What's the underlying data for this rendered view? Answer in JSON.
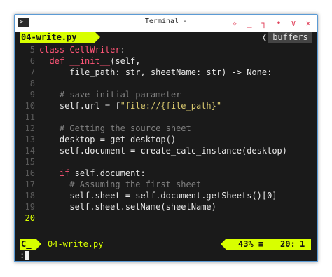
{
  "window": {
    "title": "Terminal -",
    "icon": "terminal-icon",
    "controls": [
      "pin-icon",
      "minimize-icon",
      "maximize-icon",
      "menu-icon",
      "chevron-down-icon",
      "close-icon"
    ]
  },
  "tabline": {
    "file": "04-write.py",
    "buffers_label": "buffers"
  },
  "code": [
    {
      "n": "5",
      "tokens": [
        [
          "kw",
          "class "
        ],
        [
          "fn",
          "CellWriter"
        ],
        [
          "src",
          ":"
        ]
      ]
    },
    {
      "n": "6",
      "tokens": [
        [
          "src",
          "  "
        ],
        [
          "kw",
          "def "
        ],
        [
          "fn",
          "__init__"
        ],
        [
          "src",
          "(self,"
        ]
      ]
    },
    {
      "n": "7",
      "tokens": [
        [
          "src",
          "      file_path: str, sheetName: str) -> None:"
        ]
      ]
    },
    {
      "n": "8",
      "tokens": []
    },
    {
      "n": "9",
      "tokens": [
        [
          "src",
          "    "
        ],
        [
          "cm",
          "# save initial parameter"
        ]
      ]
    },
    {
      "n": "10",
      "tokens": [
        [
          "src",
          "    self.url = f"
        ],
        [
          "st",
          "\"file://{file_path}\""
        ]
      ]
    },
    {
      "n": "11",
      "tokens": []
    },
    {
      "n": "12",
      "tokens": [
        [
          "src",
          "    "
        ],
        [
          "cm",
          "# Getting the source sheet"
        ]
      ]
    },
    {
      "n": "13",
      "tokens": [
        [
          "src",
          "    desktop = get_desktop()"
        ]
      ]
    },
    {
      "n": "14",
      "tokens": [
        [
          "src",
          "    self.document = create_calc_instance(desktop)"
        ]
      ]
    },
    {
      "n": "15",
      "tokens": []
    },
    {
      "n": "16",
      "tokens": [
        [
          "src",
          "    "
        ],
        [
          "kw",
          "if "
        ],
        [
          "src",
          "self.document:"
        ]
      ]
    },
    {
      "n": "17",
      "tokens": [
        [
          "src",
          "      "
        ],
        [
          "cm",
          "# Assuming the first sheet"
        ]
      ]
    },
    {
      "n": "18",
      "tokens": [
        [
          "src",
          "      self.sheet = self.document.getSheets()[0]"
        ]
      ]
    },
    {
      "n": "19",
      "tokens": [
        [
          "src",
          "      self.sheet.setName(sheetName)"
        ]
      ]
    },
    {
      "n": "20",
      "tokens": []
    }
  ],
  "current_line": "20",
  "statusline": {
    "mode": "C",
    "file": "04-write.py",
    "percent": "43% ≡",
    "line": "20:",
    "col": "1"
  },
  "cmdline": {
    "text": ":"
  },
  "colors": {
    "accent": "#d8ff00",
    "background": "#1a1a1a",
    "keyword": "#ff5577",
    "comment": "#808080",
    "string": "#d9c96f",
    "border": "#5b9bd5"
  }
}
